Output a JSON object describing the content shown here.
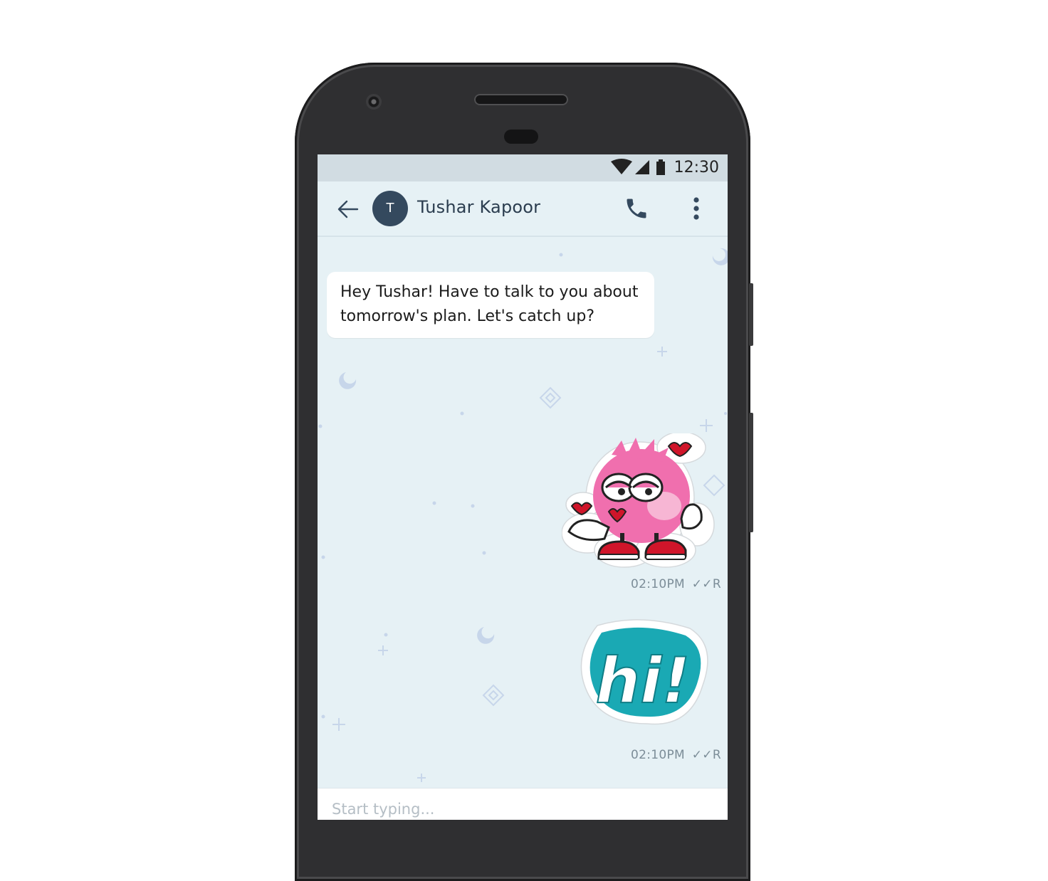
{
  "status_bar": {
    "time": "12:30",
    "icons": [
      "wifi-icon",
      "cell-signal-icon",
      "battery-icon"
    ]
  },
  "header": {
    "avatar_initial": "T",
    "contact_name": "Tushar Kapoor",
    "icons": [
      "back-arrow-icon",
      "phone-icon",
      "more-vert-icon"
    ]
  },
  "messages": [
    {
      "type": "text",
      "direction": "incoming",
      "text": "Hey Tushar! Have to talk to you about tomorrow's plan. Let's catch up?"
    },
    {
      "type": "sticker",
      "direction": "outgoing",
      "sticker": "pink-monster-kiss-sticker",
      "time": "02:10PM",
      "receipt": "R"
    },
    {
      "type": "sticker",
      "direction": "outgoing",
      "sticker": "hi-sticker",
      "sticker_text": "hi!",
      "time": "02:10PM",
      "receipt": "R"
    }
  ],
  "composer": {
    "placeholder": "Start typing..."
  },
  "colors": {
    "chat_background": "#e6f1f5",
    "status_bar": "#d1dce2",
    "avatar": "#34495e",
    "hi_sticker": "#1aa9b4",
    "monster_pink": "#f06fae"
  }
}
